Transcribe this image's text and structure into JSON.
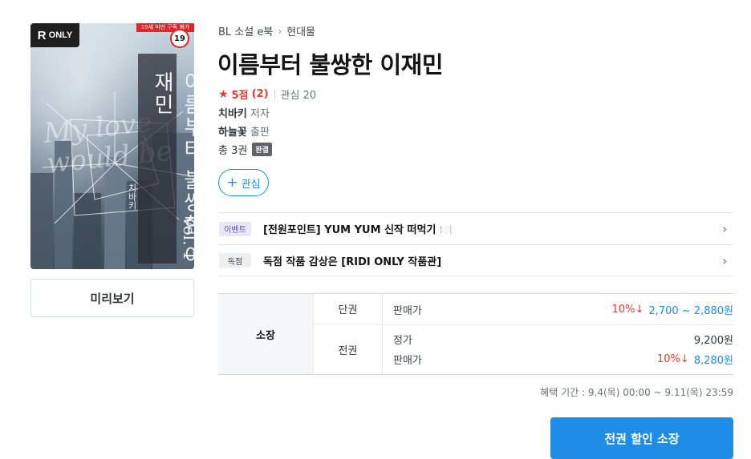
{
  "cover": {
    "badge_brand": "ONLY",
    "badge_brand_letter": "R",
    "age_strip": "19세 미만 구독 불가",
    "age_badge": "19",
    "vertical_title": "이름부터 불쌍한 이재민",
    "vertical_author": "치바키",
    "volume": "Vol. 1",
    "script_text": "My love would be",
    "colors": {
      "age_red": "#e0252a",
      "badge_dark": "#1f1f1f"
    }
  },
  "preview_button": "미리보기",
  "breadcrumb": {
    "items": [
      "BL 소설 e북",
      "현대물"
    ],
    "separator": "›"
  },
  "book": {
    "title": "이름부터 불쌍한 이재민",
    "rating_score": "5점",
    "rating_count": "(2)",
    "wish_label": "관심 20",
    "author": "치바키",
    "author_role": "저자",
    "publisher": "하늘꽃",
    "publisher_role": "출판",
    "volumes": "총 3권",
    "complete_badge": "완결"
  },
  "wish_button": {
    "icon": "plus-icon",
    "label": "관심"
  },
  "events": [
    {
      "tag": "이벤트",
      "text": "[전원포인트] YUM YUM 신작 떠먹기 🍽️",
      "icon": "chevron-right-icon"
    },
    {
      "tag": "독점",
      "text": "독점 작품 감상은 [RIDI ONLY 작품관]",
      "icon": "chevron-right-icon"
    }
  ],
  "price_table": {
    "header": "소장",
    "single": {
      "type": "단권",
      "label": "판매가",
      "discount": "10%↓",
      "price": "2,700 ~ 2,880원"
    },
    "all": {
      "type": "전권",
      "regular_label": "정가",
      "regular_price": "9,200원",
      "sale_label": "판매가",
      "discount": "10%↓",
      "sale_price": "8,280원"
    }
  },
  "benefit_period": "혜택 기간 : 9.4(목) 00:00 ~ 9.11(목) 23:59",
  "buy_button": "전권 할인 소장",
  "colors": {
    "accent": "#1f8ce6",
    "discount": "#e53a3a",
    "star": "#e53a3a"
  }
}
